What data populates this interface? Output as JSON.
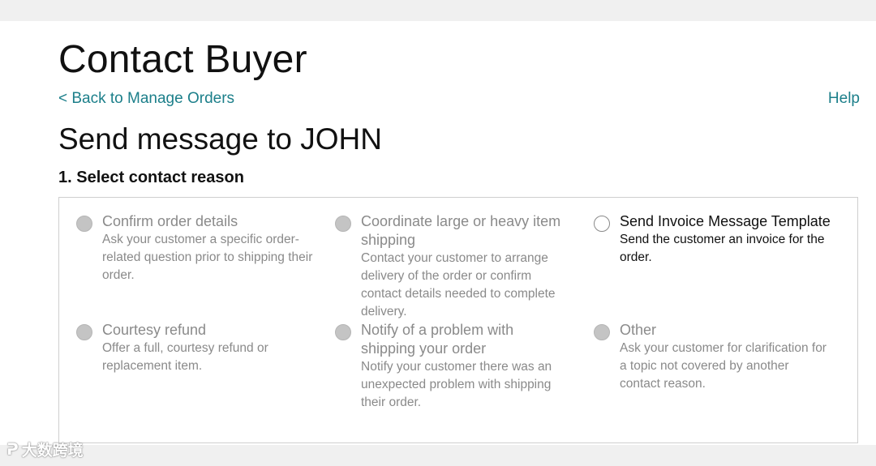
{
  "header": {
    "title": "Contact Buyer",
    "back_link": "< Back to Manage Orders",
    "help_link": "Help"
  },
  "main": {
    "subtitle": "Send message to JOHN",
    "section_heading": "1. Select contact reason"
  },
  "reasons": [
    {
      "label": "Confirm order details",
      "description": "Ask your customer a specific order-related question prior to shipping their order.",
      "enabled": false
    },
    {
      "label": "Coordinate large or heavy item shipping",
      "description": "Contact your customer to arrange delivery of the order or confirm contact details needed to complete delivery.",
      "enabled": false
    },
    {
      "label": "Send Invoice Message Template",
      "description": "Send the customer an invoice for the order.",
      "enabled": true
    },
    {
      "label": "Courtesy refund",
      "description": "Offer a full, courtesy refund or replacement item.",
      "enabled": false
    },
    {
      "label": "Notify of a problem with shipping your order",
      "description": "Notify your customer there was an unexpected problem with shipping their order.",
      "enabled": false
    },
    {
      "label": "Other",
      "description": "Ask your customer for clarification for a topic not covered by another contact reason.",
      "enabled": false
    }
  ],
  "watermark": {
    "text": "大数跨境"
  },
  "colors": {
    "link": "#1c7f8a",
    "disabled_text": "#8a8a8a"
  }
}
